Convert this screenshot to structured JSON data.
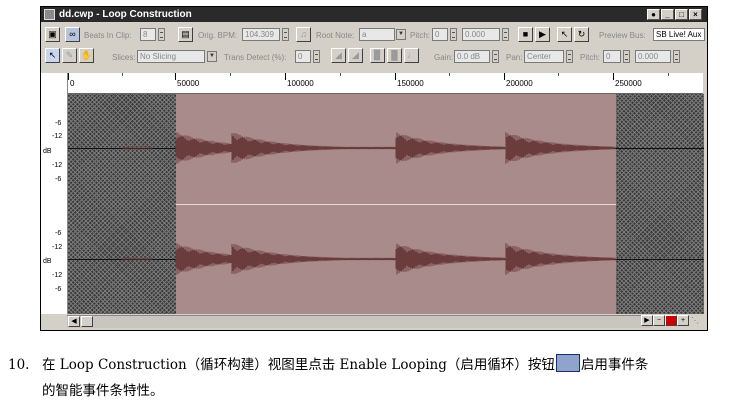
{
  "window": {
    "title": "dd.cwp - Loop Construction",
    "controls": [
      "●",
      "_",
      "□",
      "×"
    ]
  },
  "toolbar1": {
    "beats_label": "Beats In Clip:",
    "beats_value": "8",
    "bpm_label": "Orig. BPM:",
    "bpm_value": "104.309",
    "root_label": "Root Note:",
    "root_value": "a",
    "pitch_label": "Pitch:",
    "pitch_value": "0",
    "pitch_fine": "0.000",
    "preview_label": "Preview Bus:",
    "preview_value": "SB Live! Aux"
  },
  "toolbar2": {
    "slices_label": "Slices:",
    "slices_value": "No Slicing",
    "trans_label": "Trans Detect (%):",
    "trans_value": "0",
    "gain_label": "Gain:",
    "gain_value": "0.0 dB",
    "pan_label": "Pan:",
    "pan_value": "Center",
    "pitch_label": "Pitch:",
    "pitch_value": "0",
    "pitch_fine": "0.000"
  },
  "ruler": {
    "labels": [
      "0",
      "50000",
      "100000",
      "150000",
      "200000",
      "250000"
    ]
  },
  "db_scale": {
    "unit": "dB",
    "ch1": [
      "-6",
      "-12",
      "-12",
      "-6"
    ],
    "ch2": [
      "-6",
      "-12",
      "-12",
      "-6"
    ]
  },
  "colors": {
    "clip": "#a98b8b",
    "waveform": "#6b3c3c",
    "titlebar": "#2a2a2a",
    "chrome": "#d4d0c8"
  },
  "caption": {
    "number": "10.",
    "line1_part1": "在 Loop Construction（循环构建）视图里点击 Enable Looping（启用循环）按钮",
    "line1_part2": "启用事件条",
    "line2": "的智能事件条特性。"
  }
}
